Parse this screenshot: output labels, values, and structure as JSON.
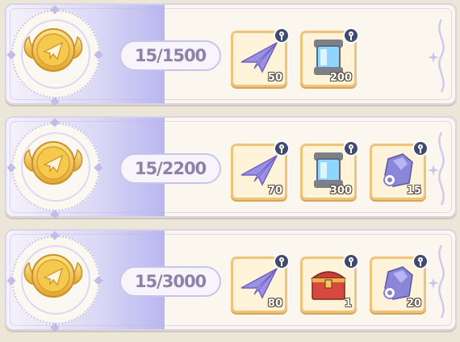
{
  "tiers": [
    {
      "progress": "15/1500",
      "rewards": [
        {
          "icon": "paper-plane-icon",
          "qty": "50"
        },
        {
          "icon": "crystal-canister-icon",
          "qty": "200"
        }
      ]
    },
    {
      "progress": "15/2200",
      "rewards": [
        {
          "icon": "paper-plane-icon",
          "qty": "70"
        },
        {
          "icon": "crystal-canister-icon",
          "qty": "300"
        },
        {
          "icon": "purple-crystal-icon",
          "qty": "15"
        }
      ]
    },
    {
      "progress": "15/3000",
      "rewards": [
        {
          "icon": "paper-plane-icon",
          "qty": "80"
        },
        {
          "icon": "treasure-chest-icon",
          "qty": "1"
        },
        {
          "icon": "purple-crystal-icon",
          "qty": "20"
        }
      ]
    }
  ],
  "colors": {
    "accent": "#b9b7f0",
    "reward_border": "#f0c37a",
    "lock": "#3e4b6e"
  }
}
